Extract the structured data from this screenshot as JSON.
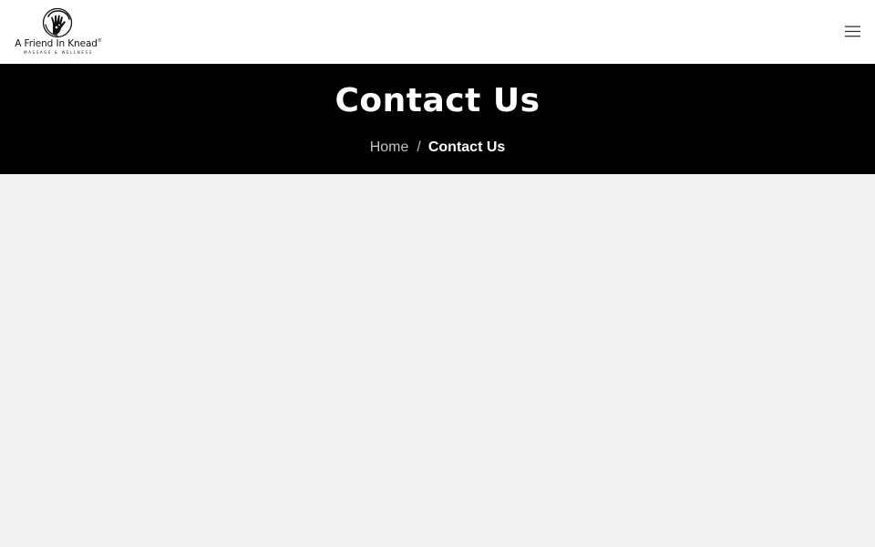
{
  "header": {
    "logo": {
      "name": "A Friend In Knead",
      "trademark": "®",
      "tagline": "MASSAGE & WELLNESS",
      "icon": "hand-print-icon"
    },
    "menu_icon": "hamburger-menu-icon"
  },
  "banner": {
    "title": "Contact Us",
    "breadcrumb": {
      "home_label": "Home",
      "separator": "/",
      "current_label": "Contact Us"
    }
  },
  "colors": {
    "banner_background": "#000000",
    "header_background": "#ffffff",
    "content_background": "#f2f2f2",
    "title_text": "#ffffff"
  }
}
